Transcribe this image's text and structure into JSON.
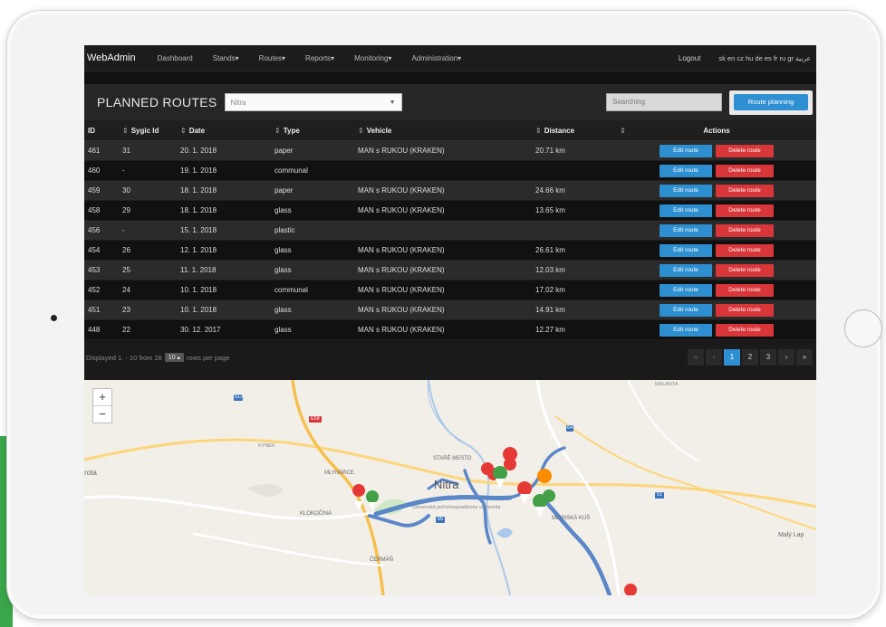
{
  "navbar": {
    "brand": "WebAdmin",
    "items": [
      "Dashboard",
      "Stands▾",
      "Routes▾",
      "Reports▾",
      "Monitoring▾",
      "Administration▾"
    ],
    "logout": "Logout",
    "languages": "sk en cz hu de es fr ru gr عربية"
  },
  "toolbar": {
    "title": "PLANNED ROUTES",
    "city_value": "Nitra",
    "search_placeholder": "Searching",
    "route_planning_label": "Route planning"
  },
  "table": {
    "columns": [
      "ID",
      "Sygic Id",
      "Date",
      "Type",
      "Vehicle",
      "Distance",
      "Actions"
    ],
    "rows": [
      {
        "id": "461",
        "sygic": "31",
        "date": "20. 1. 2018",
        "type": "paper",
        "vehicle": "MAN s RUKOU (KRAKEN)",
        "distance": "20.71 km"
      },
      {
        "id": "460",
        "sygic": "-",
        "date": "19. 1. 2018",
        "type": "communal",
        "vehicle": "",
        "distance": ""
      },
      {
        "id": "459",
        "sygic": "30",
        "date": "18. 1. 2018",
        "type": "paper",
        "vehicle": "MAN s RUKOU (KRAKEN)",
        "distance": "24.66 km"
      },
      {
        "id": "458",
        "sygic": "29",
        "date": "18. 1. 2018",
        "type": "glass",
        "vehicle": "MAN s RUKOU (KRAKEN)",
        "distance": "13.65 km"
      },
      {
        "id": "456",
        "sygic": "-",
        "date": "15. 1. 2018",
        "type": "plastic",
        "vehicle": "",
        "distance": ""
      },
      {
        "id": "454",
        "sygic": "26",
        "date": "12. 1. 2018",
        "type": "glass",
        "vehicle": "MAN s RUKOU (KRAKEN)",
        "distance": "26.61 km"
      },
      {
        "id": "453",
        "sygic": "25",
        "date": "11. 1. 2018",
        "type": "glass",
        "vehicle": "MAN s RUKOU (KRAKEN)",
        "distance": "12.03 km"
      },
      {
        "id": "452",
        "sygic": "24",
        "date": "10. 1. 2018",
        "type": "communal",
        "vehicle": "MAN s RUKOU (KRAKEN)",
        "distance": "17.02 km"
      },
      {
        "id": "451",
        "sygic": "23",
        "date": "10. 1. 2018",
        "type": "glass",
        "vehicle": "MAN s RUKOU (KRAKEN)",
        "distance": "14.91 km"
      },
      {
        "id": "448",
        "sygic": "22",
        "date": "30. 12. 2017",
        "type": "glass",
        "vehicle": "MAN s RUKOU (KRAKEN)",
        "distance": "12.27 km"
      }
    ],
    "edit_label": "Edit route",
    "delete_label": "Delete route"
  },
  "footer": {
    "displayed": "Displayed 1. - 10 from 28",
    "rows_value": "10 ▴",
    "rows_suffix": "rows per page",
    "pages": [
      "«",
      "‹",
      "1",
      "2",
      "3",
      "›",
      "»"
    ]
  },
  "map": {
    "zoom_in": "+",
    "zoom_out": "−",
    "labels": {
      "city": "Nitra",
      "mlynarce": "MLYNÁRCE",
      "klokocina": "KLOKOČINA",
      "stare_mesto": "STARÉ MESTO",
      "cermat": "ČERMÁŇ",
      "mlynska": "MLYNSKÁ KÚŠ",
      "maly_lap": "Malý Lap",
      "kynek": "KYNEK",
      "university": "Slovenská poľnohospodárska univerzita",
      "rota": "rota",
      "malanta": "MALANTA",
      "road_513": "513",
      "road_64": "64",
      "road_e58": "E58",
      "road_65": "65",
      "road_51": "51"
    }
  },
  "colors": {
    "route_line": "#5b87c9",
    "marker_red": "#e53935",
    "marker_green": "#43a047",
    "marker_orange": "#fb8c00",
    "accent_blue": "#2f8fd3",
    "delete_red": "#d9363a"
  }
}
